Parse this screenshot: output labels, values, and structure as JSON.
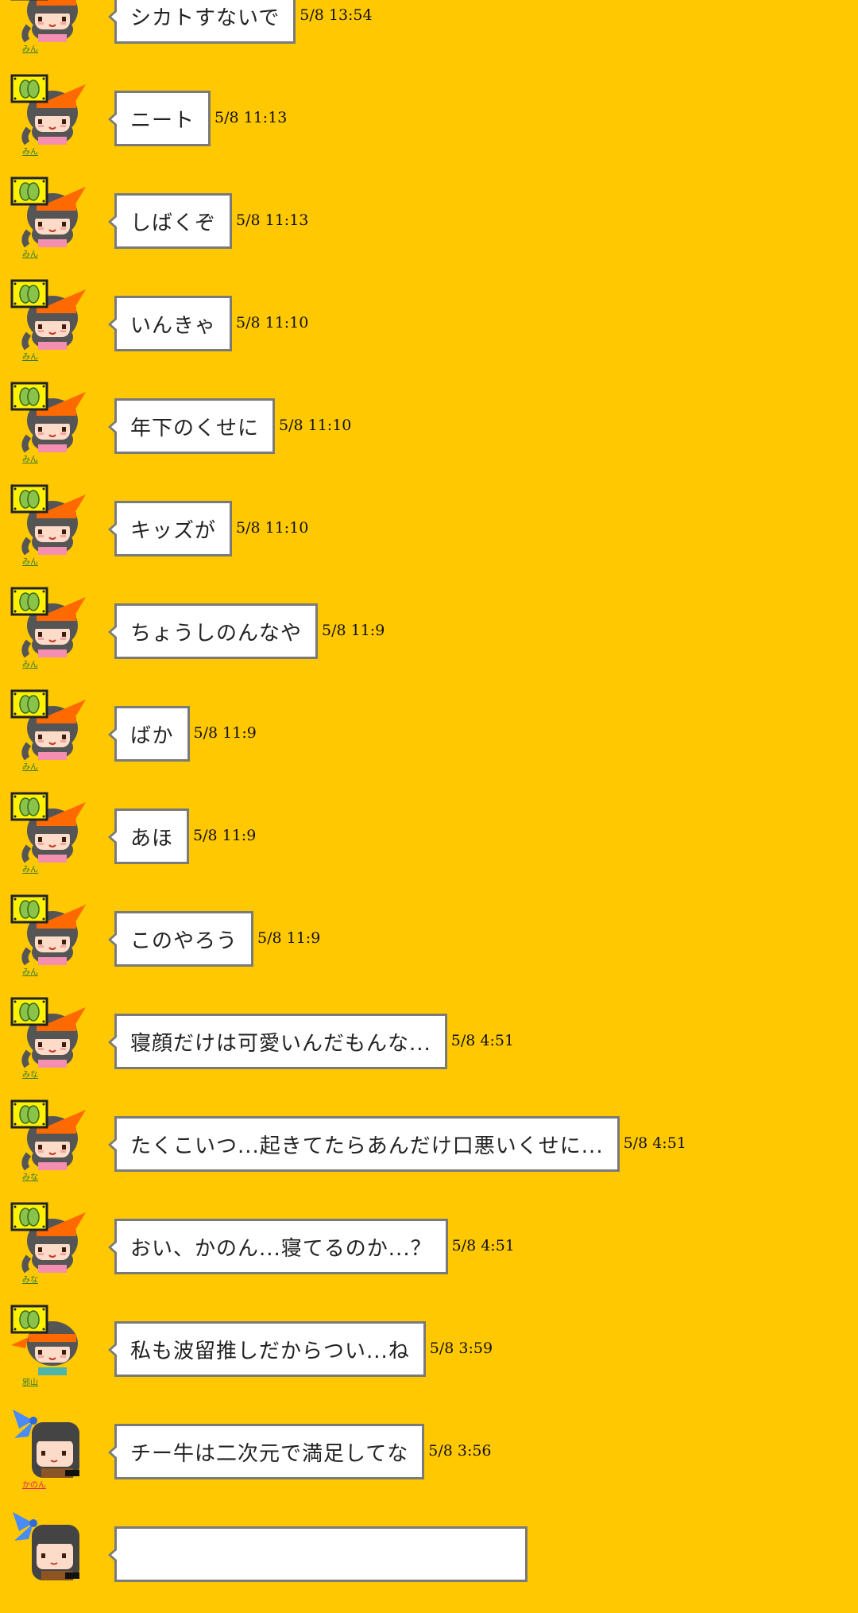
{
  "messages": [
    {
      "text": "シカトすないで",
      "time": "5/8 13:54",
      "user": "みん",
      "avatar": "orange-bow-badge-girl-icon"
    },
    {
      "text": "ニート",
      "time": "5/8 11:13",
      "user": "みん",
      "avatar": "orange-bow-badge-girl-icon"
    },
    {
      "text": "しばくぞ",
      "time": "5/8 11:13",
      "user": "みん",
      "avatar": "orange-bow-badge-girl-icon"
    },
    {
      "text": "いんきゃ",
      "time": "5/8 11:10",
      "user": "みん",
      "avatar": "orange-bow-badge-girl-icon"
    },
    {
      "text": "年下のくせに",
      "time": "5/8 11:10",
      "user": "みん",
      "avatar": "orange-bow-badge-girl-icon"
    },
    {
      "text": "キッズが",
      "time": "5/8 11:10",
      "user": "みん",
      "avatar": "orange-bow-badge-girl-icon"
    },
    {
      "text": "ちょうしのんなや",
      "time": "5/8 11:9",
      "user": "みん",
      "avatar": "orange-bow-badge-girl-icon"
    },
    {
      "text": "ばか",
      "time": "5/8 11:9",
      "user": "みん",
      "avatar": "orange-bow-badge-girl-icon"
    },
    {
      "text": "あほ",
      "time": "5/8 11:9",
      "user": "みん",
      "avatar": "orange-bow-badge-girl-icon"
    },
    {
      "text": "このやろう",
      "time": "5/8 11:9",
      "user": "みん",
      "avatar": "orange-bow-badge-girl-icon"
    },
    {
      "text": "寝顔だけは可愛いんだもんな...",
      "time": "5/8 4:51",
      "user": "みな",
      "avatar": "orange-bow-badge-girl-icon"
    },
    {
      "text": "たくこいつ...起きてたらあんだけ口悪いくせに...",
      "time": "5/8 4:51",
      "user": "みな",
      "avatar": "orange-bow-badge-girl-icon"
    },
    {
      "text": "おい、かのん...寝てるのか...？",
      "time": "5/8 4:51",
      "user": "みな",
      "avatar": "orange-bow-badge-girl-icon"
    },
    {
      "text": "私も波留推しだからつい...ね",
      "time": "5/8 3:59",
      "user": "邪山",
      "avatar": "orange-headband-badge-boy-icon"
    },
    {
      "text": "チー牛は二次元で満足してな",
      "time": "5/8 3:56",
      "user": "かのん",
      "avatar": "blue-bow-girl-icon"
    },
    {
      "text": "",
      "time": "",
      "user": "",
      "avatar": "blue-bow-girl-icon"
    }
  ],
  "colors": {
    "background": "#FFC800",
    "bubble": "#FFFFFF",
    "bubble_border": "#7A7A7A",
    "username_green": "#2E7D32",
    "username_pink": "#E91E63"
  }
}
